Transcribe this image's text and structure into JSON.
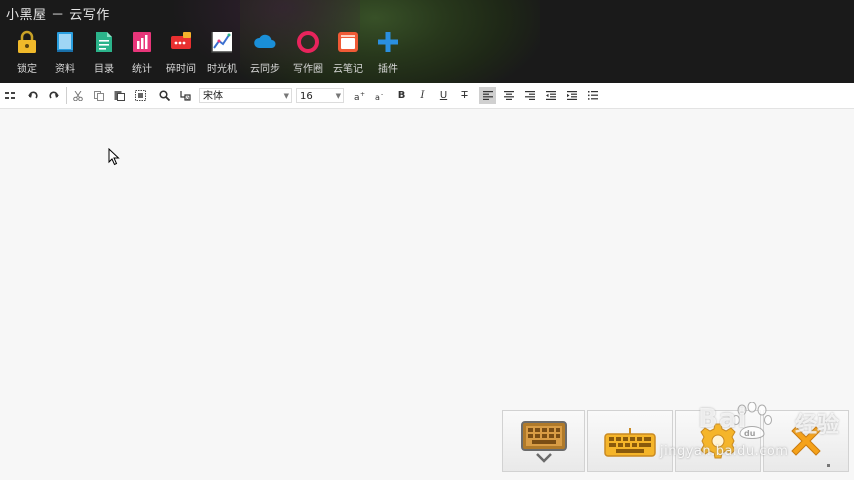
{
  "app": {
    "title": "小黑屋 － 云写作"
  },
  "nav": {
    "items": [
      {
        "label": "锁定",
        "icon": "lock-icon"
      },
      {
        "label": "资料",
        "icon": "book-icon"
      },
      {
        "label": "目录",
        "icon": "document-icon"
      },
      {
        "label": "统计",
        "icon": "chart-icon"
      },
      {
        "label": "碎时间",
        "icon": "message-icon"
      },
      {
        "label": "时光机",
        "icon": "line-chart-icon"
      },
      {
        "label": "云同步",
        "icon": "cloud-icon"
      },
      {
        "label": "写作圈",
        "icon": "ring-icon"
      },
      {
        "label": "云笔记",
        "icon": "note-icon"
      },
      {
        "label": "插件",
        "icon": "plus-icon"
      }
    ]
  },
  "toolbar": {
    "font_family": "宋体",
    "font_size": "16",
    "bold": "B",
    "italic": "I",
    "underline": "U",
    "strike": "T"
  },
  "watermark": {
    "brand": "Bai",
    "brand_cn": "经验",
    "sub": "jingyan.baidu.com"
  },
  "colors": {
    "header_bg": "#1a1a1a",
    "editor_bg": "#f7f7f7",
    "accent_pink": "#e8245c",
    "accent_blue": "#1a8fd8"
  }
}
